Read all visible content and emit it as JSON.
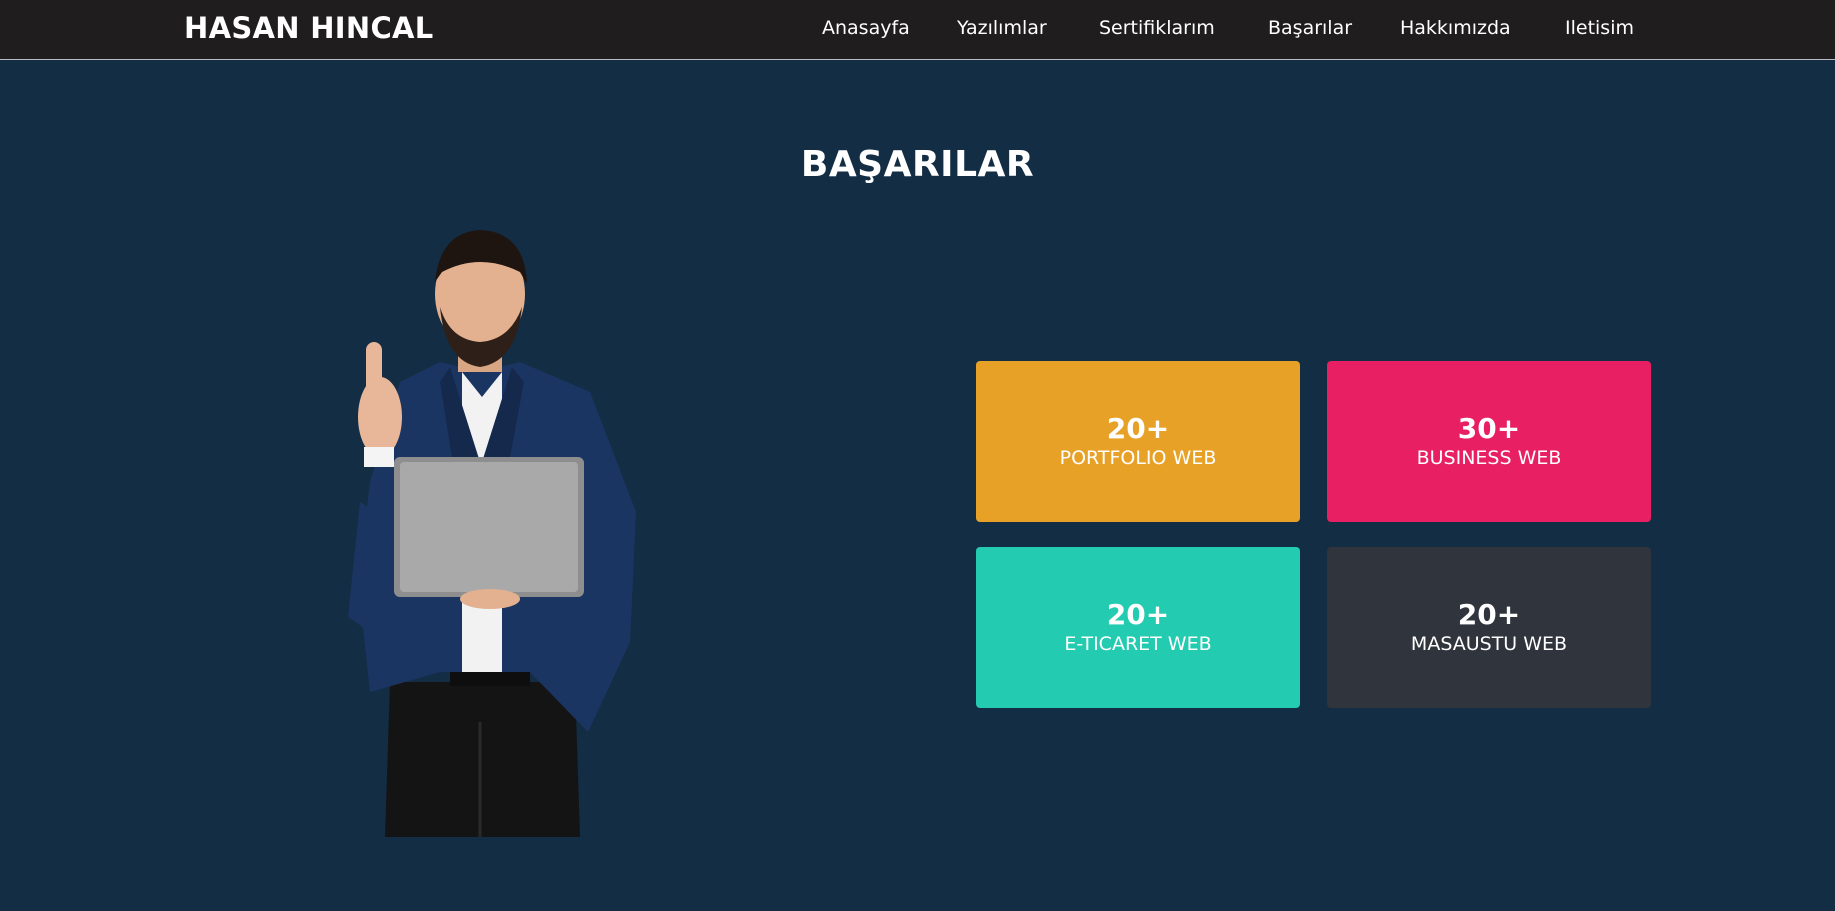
{
  "header": {
    "brand": "HASAN HINCAL",
    "nav": [
      "Anasayfa",
      "Yazılımlar",
      "Sertifiklarım",
      "Başarılar",
      "Hakkımızda",
      "Iletisim"
    ]
  },
  "section": {
    "title": "BAŞARILAR"
  },
  "cards": [
    {
      "count": "20+",
      "label": "PORTFOLIO WEB",
      "color": "#e8a127"
    },
    {
      "count": "30+",
      "label": "BUSINESS WEB",
      "color": "#e81f63"
    },
    {
      "count": "20+",
      "label": "E-TICARET WEB",
      "color": "#23cbb0"
    },
    {
      "count": "20+",
      "label": "MASAUSTU WEB",
      "color": "#2f343d"
    }
  ],
  "colors": {
    "background": "#132d45",
    "navbar": "#1f1d1e"
  }
}
